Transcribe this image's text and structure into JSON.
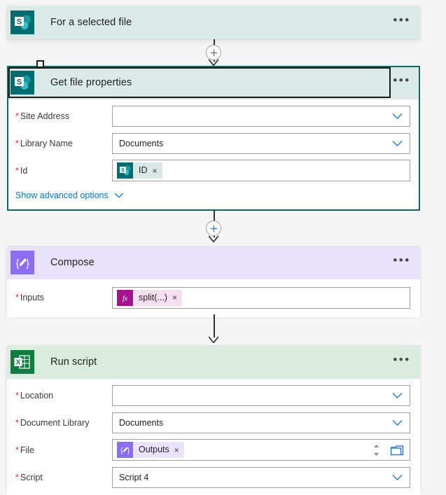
{
  "flow": {
    "steps": [
      {
        "id": "trigger",
        "title": "For a selected file",
        "connector": "sharepoint",
        "icon_name": "sharepoint-icon",
        "accent": "#036c70",
        "header_bg": "#dbe9e7",
        "collapsed": true,
        "menu_label": "•••",
        "fields": []
      },
      {
        "id": "get-file-properties",
        "title": "Get file properties",
        "connector": "sharepoint",
        "icon_name": "sharepoint-icon",
        "accent": "#036c70",
        "header_bg": "#dbe9e7",
        "selected": true,
        "menu_label": "•••",
        "fields": [
          {
            "label": "Site Address",
            "required": true,
            "type": "dropdown",
            "value": ""
          },
          {
            "label": "Library Name",
            "required": true,
            "type": "dropdown",
            "value": "Documents"
          },
          {
            "label": "Id",
            "required": true,
            "type": "token",
            "token": {
              "text": "ID",
              "icon_name": "sharepoint-token-icon",
              "style": "sharepoint",
              "remove_label": "×"
            }
          }
        ],
        "advanced_link": "Show advanced options"
      },
      {
        "id": "compose",
        "title": "Compose",
        "connector": "compose",
        "icon_name": "compose-icon",
        "accent": "#8c6cf0",
        "header_bg": "#e8e3fb",
        "menu_label": "•••",
        "fields": [
          {
            "label": "Inputs",
            "required": true,
            "type": "token",
            "token": {
              "text": "split(...)",
              "icon_name": "function-fx-icon",
              "style": "function",
              "remove_label": "×"
            }
          }
        ]
      },
      {
        "id": "run-script",
        "title": "Run script",
        "connector": "excel",
        "icon_name": "excel-icon",
        "accent": "#107c41",
        "header_bg": "#d9ecdd",
        "menu_label": "•••",
        "fields": [
          {
            "label": "Location",
            "required": true,
            "type": "dropdown",
            "value": ""
          },
          {
            "label": "Document Library",
            "required": true,
            "type": "dropdown",
            "value": "Documents"
          },
          {
            "label": "File",
            "required": true,
            "type": "token-picker",
            "token": {
              "text": "Outputs",
              "icon_name": "compose-token-icon",
              "style": "compose",
              "remove_label": "×"
            },
            "picker_icon_name": "folder-picker-icon",
            "spinner_icon_name": "spinner-updown-icon"
          },
          {
            "label": "Script",
            "required": true,
            "type": "dropdown",
            "value": "Script 4"
          }
        ]
      }
    ],
    "connectors": [
      {
        "id": "conn-1",
        "has_plus": true,
        "plus_label": "+",
        "from": "trigger",
        "to": "get-file-properties"
      },
      {
        "id": "conn-2",
        "has_plus": true,
        "plus_label": "+",
        "from": "get-file-properties",
        "to": "compose"
      },
      {
        "id": "conn-3",
        "has_plus": false,
        "plus_label": "",
        "from": "compose",
        "to": "run-script"
      }
    ],
    "colors": {
      "canvas_bg": "#f5f5f5",
      "card_bg": "#ffffff",
      "required_star": "#d93025",
      "link": "#0078d4",
      "chevron": "#2b7cd3",
      "selected_border": "#1b1a19",
      "focus_border": "#0b6a67",
      "sharepoint_teal": "#036c70",
      "compose_purple": "#8c6cf0",
      "excel_green": "#107c41",
      "function_magenta": "#a4262c"
    }
  }
}
